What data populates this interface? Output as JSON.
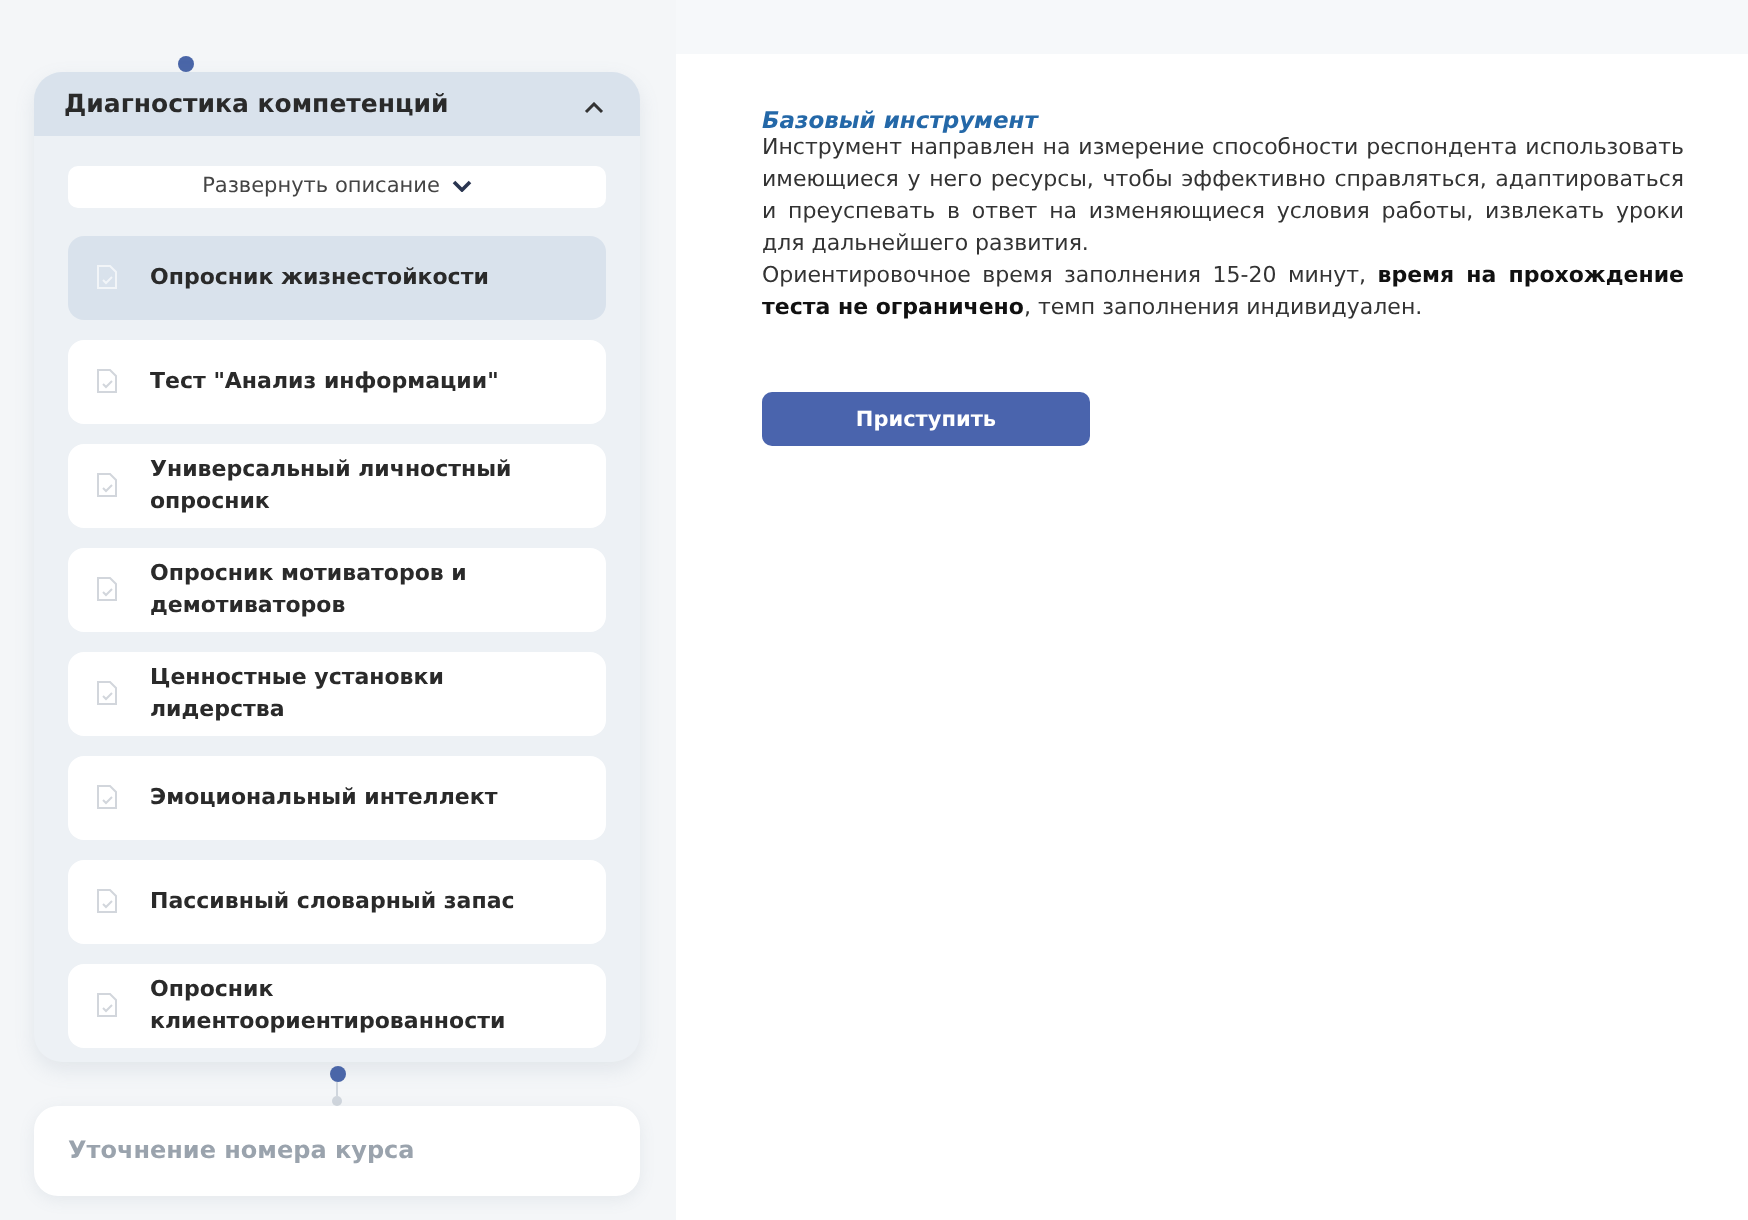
{
  "stage": {
    "title": "Диагностика компетенций",
    "expanded": true,
    "description_toggle": "Развернуть описание",
    "items": [
      {
        "label": "Опросник жизнестойкости",
        "selected": true
      },
      {
        "label": "Тест \"Анализ информации\"",
        "selected": false
      },
      {
        "label": "Универсальный личностный опросник",
        "selected": false
      },
      {
        "label": "Опросник мотиваторов и демотиваторов",
        "selected": false
      },
      {
        "label": "Ценностные установки лидерства",
        "selected": false
      },
      {
        "label": "Эмоциональный интеллект",
        "selected": false
      },
      {
        "label": "Пассивный словарный запас",
        "selected": false
      },
      {
        "label": "Опросник клиентоориентированности",
        "selected": false
      }
    ]
  },
  "next_stage": {
    "title": "Уточнение номера курса",
    "disabled": true
  },
  "content": {
    "heading": "Базовый инструмент",
    "paragraphs": [
      "Инструмент направлен на измерение способности респондента использовать имеющиеся у него ресурсы, чтобы эффективно справляться, адаптироваться и преуспевать в ответ на изменяющиеся условия работы, извлекать уроки для дальнейшего развития.",
      "Ориентировочное время заполнения 15-20 минут, **время на прохождение теста не ограничено**, темп заполнения индивидуален."
    ],
    "button": "Приступить"
  }
}
